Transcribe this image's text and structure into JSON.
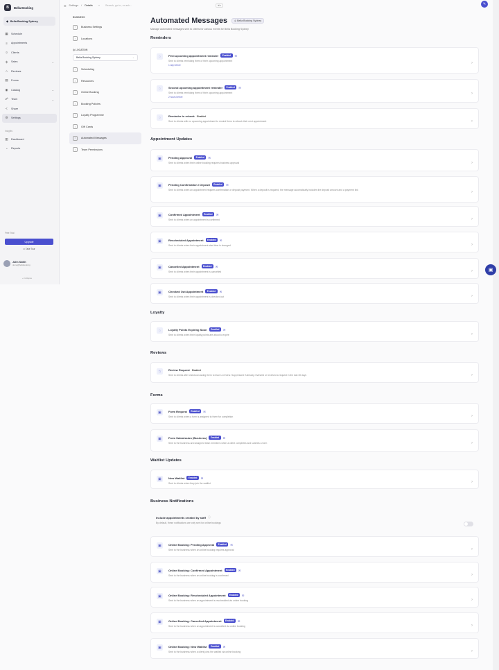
{
  "sidebar": {
    "brand": "Bella Booking",
    "location": "Bella Booking Sydney",
    "nav": [
      {
        "label": "Schedule",
        "icon": "calendar-icon"
      },
      {
        "label": "Appointments",
        "icon": "list-icon"
      },
      {
        "label": "Clients",
        "icon": "users-icon"
      },
      {
        "label": "Sales",
        "icon": "dollar-icon",
        "chevron": true
      },
      {
        "label": "Reviews",
        "icon": "star-icon"
      },
      {
        "label": "Forms",
        "icon": "form-icon"
      },
      {
        "label": "Catalog",
        "icon": "catalog-icon",
        "chevron": true
      },
      {
        "label": "Team",
        "icon": "team-icon",
        "chevron": true
      },
      {
        "label": "Share",
        "icon": "share-icon"
      },
      {
        "label": "Settings",
        "icon": "gear-icon",
        "active": true
      }
    ],
    "group_label": "Insights",
    "insights": [
      {
        "label": "Dashboard",
        "icon": "chart-icon"
      },
      {
        "label": "Reports",
        "icon": "report-icon"
      }
    ],
    "plan": "Free Trial",
    "upgrade_label": "Upgrade",
    "tour_label": "Take Tour",
    "user_name": "John Smith",
    "user_email": "demo@bellabooking",
    "collapse_label": "Collapse"
  },
  "topbar": {
    "crumb1": "Settings",
    "sep": "/",
    "crumb2": "Details",
    "search_placeholder": "Search, go to, or ask...",
    "kbd": "⌘K"
  },
  "subnav": {
    "business_header": "BUSINESS",
    "business_items": [
      {
        "label": "Business Settings"
      },
      {
        "label": "Locations"
      }
    ],
    "location_header": "LOCATION",
    "location_select": "Bella Booking Sydney",
    "location_items": [
      {
        "label": "Scheduling"
      },
      {
        "label": "Resources"
      },
      {
        "label": "Online Booking"
      },
      {
        "label": "Booking Policies"
      },
      {
        "label": "Loyalty Programme"
      },
      {
        "label": "Gift Cards"
      },
      {
        "label": "Automated Messages",
        "active": true
      },
      {
        "label": "Team Permissions"
      }
    ]
  },
  "page": {
    "title": "Automated Messages",
    "location_badge": "Bella Booking Sydney",
    "description": "Manage automated messages sent to clients for various events for Bella Booking Sydney"
  },
  "sections": [
    {
      "title": "Reminders",
      "rows": [
        {
          "title": "First upcoming appointment reminder",
          "status": "Enabled",
          "desc": "Sent to clients reminding them of their upcoming appointment",
          "timing": "1 day before"
        },
        {
          "title": "Second upcoming appointment reminder",
          "status": "Enabled",
          "desc": "Sent to clients reminding them of their upcoming appointment",
          "timing": "2 hours before"
        },
        {
          "title": "Reminder to rebook",
          "status": "Disabled",
          "desc": "Sent to clients with no upcoming appointment to remind them to rebook their next appointment"
        }
      ]
    },
    {
      "title": "Appointment Updates",
      "rows": [
        {
          "title": "Pending Approval",
          "status": "Enabled",
          "desc": "Sent to clients when their online booking requires business approval"
        },
        {
          "title": "Pending Confirmation / Deposit",
          "status": "Enabled",
          "desc": "Sent to clients when an appointment requires confirmation or deposit payment. When a deposit is required, the message automatically includes the deposit amount and a payment link"
        },
        {
          "title": "Confirmed Appointment",
          "status": "Enabled",
          "desc": "Sent to clients when an appointment is confirmed"
        },
        {
          "title": "Rescheduled Appointment",
          "status": "Enabled",
          "desc": "Sent to clients when their appointment start time is changed"
        },
        {
          "title": "Cancelled Appointment",
          "status": "Enabled",
          "desc": "Sent to clients when their appointment is cancelled"
        },
        {
          "title": "Checked Out Appointment",
          "status": "Enabled",
          "desc": "Sent to clients when their appointment is checked out"
        }
      ]
    },
    {
      "title": "Loyalty",
      "rows": [
        {
          "title": "Loyalty Points Expiring Soon",
          "status": "Enabled",
          "desc": "Sent to clients when their loyalty points are about to expire"
        }
      ]
    },
    {
      "title": "Reviews",
      "rows": [
        {
          "title": "Review Request",
          "status": "Disabled",
          "desc": "Sent to clients after checkout asking them to leave a review. Suppressed if already reviewed or received a request in the last 30 days"
        }
      ]
    },
    {
      "title": "Forms",
      "rows": [
        {
          "title": "Form Request",
          "status": "Enabled",
          "desc": "Sent to clients when a form is assigned to them for completion"
        },
        {
          "title": "Form Submission (Business)",
          "status": "Enabled",
          "desc": "Sent to the business and assigned team members when a client completes and submits a form"
        }
      ]
    },
    {
      "title": "Waitlist Updates",
      "rows": [
        {
          "title": "New Waitlist",
          "status": "Enabled",
          "desc": "Sent to clients when they join the waitlist"
        }
      ]
    },
    {
      "title": "Business Notifications",
      "toggle": {
        "title": "Include appointments created by staff",
        "desc": "By default, these notifications are only sent for online bookings"
      },
      "rows": [
        {
          "title": "Online Booking: Pending Approval",
          "status": "Enabled",
          "desc": "Sent to the business when an online booking requires approval"
        },
        {
          "title": "Online Booking: Confirmed Appointment",
          "status": "Enabled",
          "desc": "Sent to the business when an online booking is confirmed"
        },
        {
          "title": "Online Booking: Rescheduled Appointment",
          "status": "Enabled",
          "desc": "Sent to the business when an appointment is rescheduled via online booking"
        },
        {
          "title": "Online Booking: Cancelled Appointment",
          "status": "Enabled",
          "desc": "Sent to the business when an appointment is cancelled via online booking"
        },
        {
          "title": "Online Booking: New Waitlist",
          "status": "Enabled",
          "desc": "Sent to the business when a client joins the waitlist via online booking"
        }
      ]
    }
  ],
  "colors": {
    "accent": "#4a4fcf",
    "enabled_badge": "#4a4fcf"
  }
}
